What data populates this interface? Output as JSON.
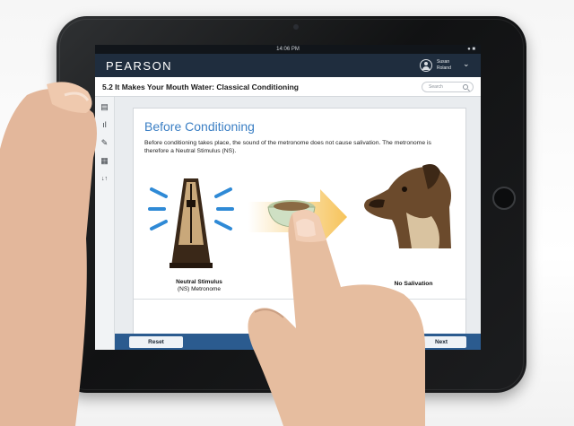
{
  "device": {
    "status_time": "14:06 PM",
    "status_battery": "●  ■"
  },
  "app": {
    "brand": "PEARSON",
    "user": {
      "name": "Susan Roland"
    },
    "lesson_title": "5.2 It Makes Your Mouth Water: Classical Conditioning",
    "search_placeholder": "Search"
  },
  "sidebar": {
    "items": [
      {
        "icon": "notebook-icon",
        "glyph": "▤"
      },
      {
        "icon": "bar-chart-icon",
        "glyph": "ıl"
      },
      {
        "icon": "pencil-icon",
        "glyph": "✎"
      },
      {
        "icon": "layers-icon",
        "glyph": "▦"
      },
      {
        "icon": "sort-icon",
        "glyph": "↓↑"
      }
    ]
  },
  "card": {
    "title": "Before Conditioning",
    "body": "Before conditioning takes place, the sound of the metronome does not cause salivation. The metronome is therefore a Neutral Stimulus (NS).",
    "stimulus_title": "Neutral Stimulus",
    "stimulus_subtitle": "(NS) Metronome",
    "result_label": "No Salivation"
  },
  "footer": {
    "reset_label": "Reset",
    "next_label": "Next"
  },
  "colors": {
    "app_bar": "#1f2d3e",
    "title_accent": "#3b7fc4",
    "footer": "#2b5b8f",
    "arrow": "#f6c35a"
  }
}
